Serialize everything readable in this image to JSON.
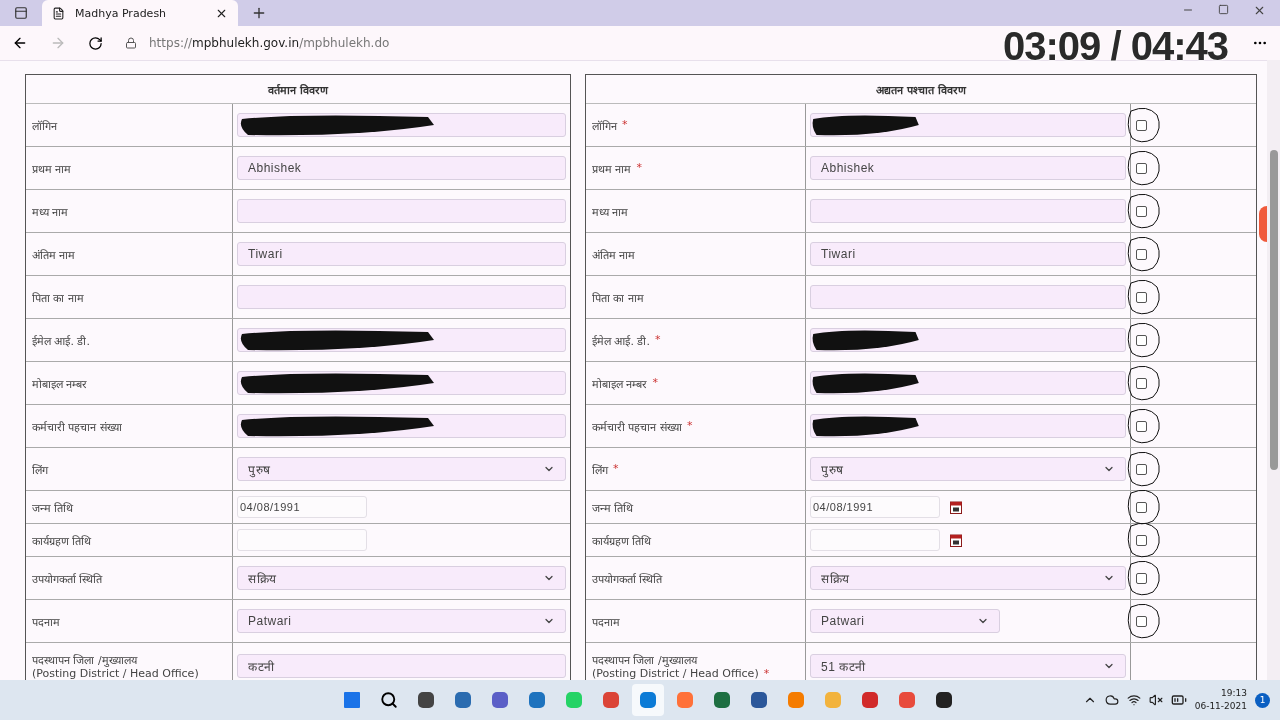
{
  "browser": {
    "tab_title": "Madhya Pradesh",
    "url": "https://**mpbhulekh.gov.in**/mpbhulekh.do"
  },
  "video_overlay": {
    "time": "03:09 / 04:43"
  },
  "current": {
    "title": "वर्तमान विवरण",
    "rows": [
      {
        "label": "लॉगिन",
        "kind": "text",
        "redacted": true
      },
      {
        "label": "प्रथम नाम",
        "kind": "text",
        "value": "Abhishek"
      },
      {
        "label": "मध्य नाम",
        "kind": "text"
      },
      {
        "label": "अंतिम नाम",
        "kind": "text",
        "value": "Tiwari"
      },
      {
        "label": "पिता का नाम",
        "kind": "text"
      },
      {
        "label": "ईमेल आई. डी.",
        "kind": "text",
        "redacted": true
      },
      {
        "label": "मोबाइल नम्बर",
        "kind": "text",
        "redacted": true
      },
      {
        "label": "कर्मचारी पहचान संख्या",
        "kind": "text",
        "redacted": true
      },
      {
        "label": "लिंग",
        "kind": "select",
        "value": "पुरुष"
      },
      {
        "label": "जन्म तिथि",
        "kind": "date",
        "value": "04/08/1991"
      },
      {
        "label": "कार्यग्रहण तिथि",
        "kind": "date"
      },
      {
        "label": "उपयोगकर्ता स्थिति",
        "kind": "select",
        "value": "सक्रिय"
      },
      {
        "label": "पदनाम",
        "kind": "select",
        "value": "Patwari"
      },
      {
        "label": "पदस्थापन जिला /मुख्यालय",
        "note": "(Posting District / Head Office)",
        "kind": "text",
        "value": "कटनी"
      }
    ]
  },
  "updated": {
    "title": "अद्यतन पश्चात विवरण",
    "rows": [
      {
        "label": "लॉगिन",
        "required": "*",
        "kind": "text",
        "redacted": true,
        "checked": false
      },
      {
        "label": "प्रथम नाम",
        "required": "*",
        "kind": "text",
        "value": "Abhishek",
        "checked": false
      },
      {
        "label": "मध्य नाम",
        "kind": "text",
        "checked": false
      },
      {
        "label": "अंतिम नाम",
        "kind": "text",
        "value": "Tiwari",
        "checked": false
      },
      {
        "label": "पिता का नाम",
        "kind": "text",
        "checked": false
      },
      {
        "label": "ईमेल आई. डी.",
        "required": "*",
        "kind": "text",
        "redacted": true,
        "checked": false
      },
      {
        "label": "मोबाइल नम्बर",
        "required": "*",
        "kind": "text",
        "redacted": true,
        "checked": false
      },
      {
        "label": "कर्मचारी पहचान संख्या",
        "required": "*",
        "kind": "text",
        "redacted": true,
        "checked": false
      },
      {
        "label": "लिंग",
        "required": "*",
        "kind": "select",
        "value": "पुरुष",
        "checked": false
      },
      {
        "label": "जन्म तिथि",
        "kind": "date",
        "value": "04/08/1991",
        "checked": false
      },
      {
        "label": "कार्यग्रहण तिथि",
        "kind": "date",
        "checked": false
      },
      {
        "label": "उपयोगकर्ता स्थिति",
        "kind": "select",
        "value": "सक्रिय",
        "checked": false
      },
      {
        "label": "पदनाम",
        "kind": "short_select",
        "value": "Patwari",
        "checked": false
      },
      {
        "label": "पदस्थापन जिला /मुख्यालय",
        "note": "(Posting District / Head Office)",
        "required": "*",
        "kind": "select",
        "value": "51 कटनी"
      }
    ]
  },
  "taskbar": {
    "time": "19:13",
    "date": "06-11-2021",
    "notifications": "1"
  }
}
